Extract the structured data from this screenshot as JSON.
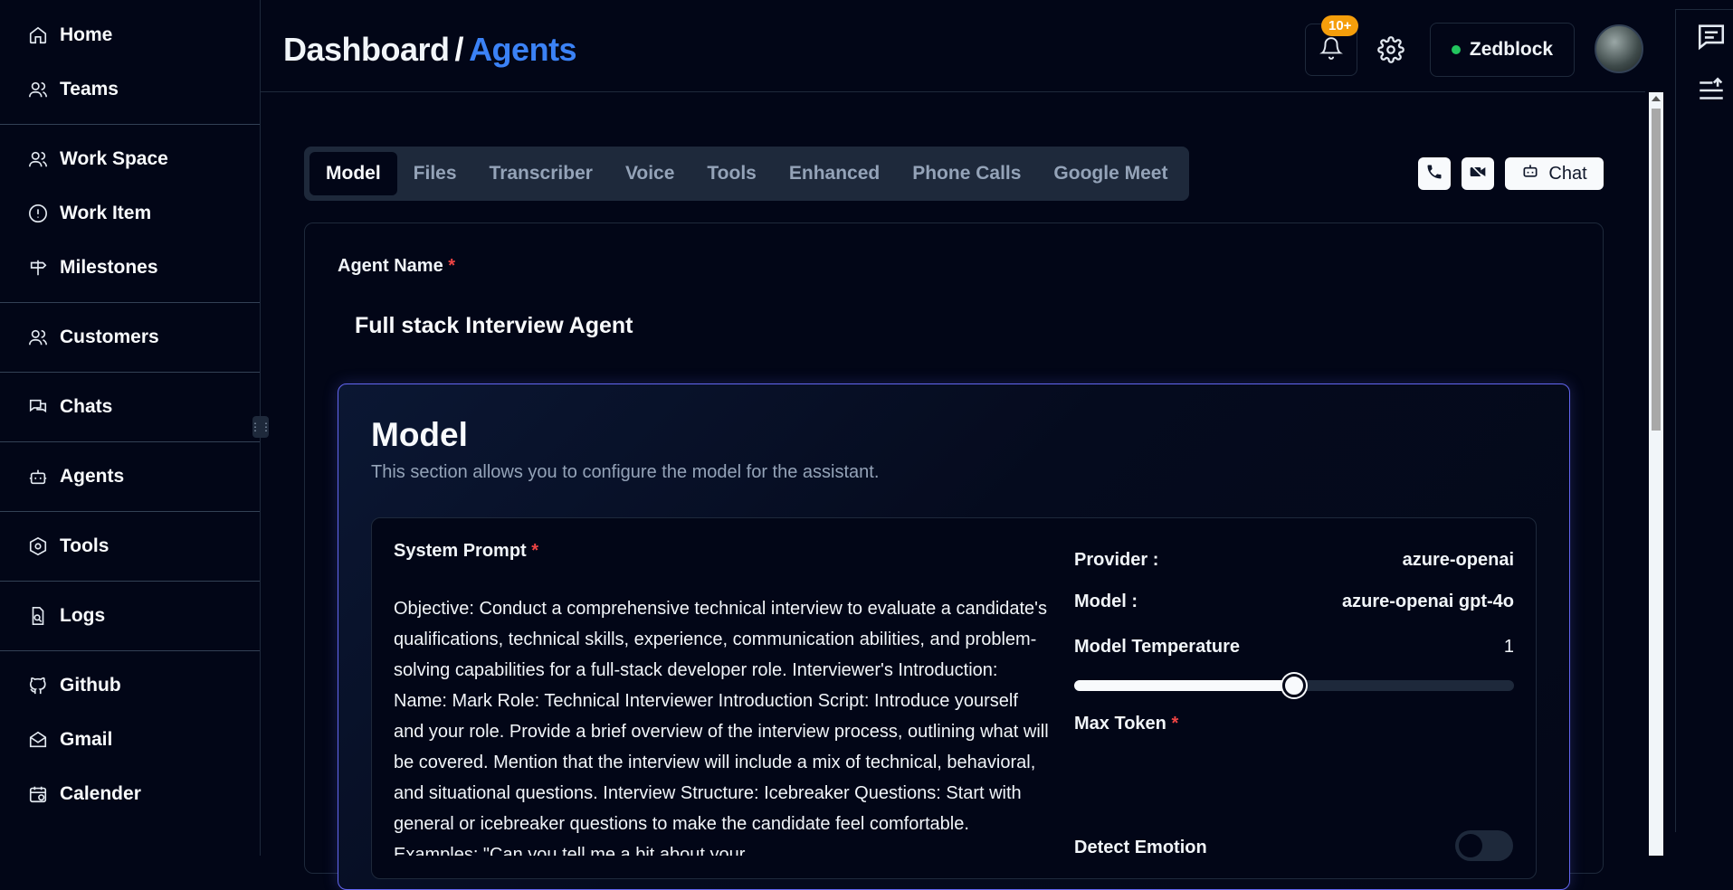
{
  "sidebar": {
    "items": [
      {
        "label": "Home",
        "icon": "home-icon"
      },
      {
        "label": "Teams",
        "icon": "users-icon"
      },
      {
        "label": "Work Space",
        "icon": "users-icon"
      },
      {
        "label": "Work Item",
        "icon": "alert-circle-icon"
      },
      {
        "label": "Milestones",
        "icon": "signpost-icon"
      },
      {
        "label": "Customers",
        "icon": "users-icon"
      },
      {
        "label": "Chats",
        "icon": "messages-icon"
      },
      {
        "label": "Agents",
        "icon": "bot-icon"
      },
      {
        "label": "Tools",
        "icon": "hexagon-icon"
      },
      {
        "label": "Logs",
        "icon": "file-search-icon"
      },
      {
        "label": "Github",
        "icon": "github-icon"
      },
      {
        "label": "Gmail",
        "icon": "mail-icon"
      },
      {
        "label": "Calender",
        "icon": "calendar-icon"
      }
    ]
  },
  "header": {
    "breadcrumb_root": "Dashboard",
    "breadcrumb_sep": "/",
    "breadcrumb_current": "Agents",
    "notification_badge": "10+",
    "org_name": "Zedblock",
    "org_status_color": "#22c55e",
    "accent_color": "#3b82f6"
  },
  "tabs": [
    "Model",
    "Files",
    "Transcriber",
    "Voice",
    "Tools",
    "Enhanced",
    "Phone Calls",
    "Google Meet"
  ],
  "active_tab": "Model",
  "actions": {
    "chat_label": "Chat"
  },
  "agent": {
    "name_label": "Agent Name",
    "required_mark": "*",
    "name_value": "Full stack Interview Agent"
  },
  "model_section": {
    "title": "Model",
    "subtitle": "This section allows you to configure the model for the assistant.",
    "system_prompt_label": "System Prompt",
    "system_prompt": "Objective: Conduct a comprehensive technical interview to evaluate a candidate's qualifications, technical skills, experience, communication abilities, and problem-solving capabilities for a full-stack developer role. Interviewer's Introduction: Name: Mark Role: Technical Interviewer Introduction Script: Introduce yourself and your role. Provide a brief overview of the interview process, outlining what will be covered. Mention that the interview will include a mix of technical, behavioral, and situational questions. Interview Structure: Icebreaker Questions: Start with general or icebreaker questions to make the candidate feel comfortable. Examples: \"Can you tell me a bit about your",
    "provider_label": "Provider :",
    "provider_value": "azure-openai",
    "model_label": "Model :",
    "model_value": "azure-openai gpt-4o",
    "temperature_label": "Model Temperature",
    "temperature_value": "1",
    "temperature_fraction": 0.5,
    "max_token_label": "Max Token",
    "detect_emotion_label": "Detect Emotion",
    "detect_emotion_enabled": false
  }
}
